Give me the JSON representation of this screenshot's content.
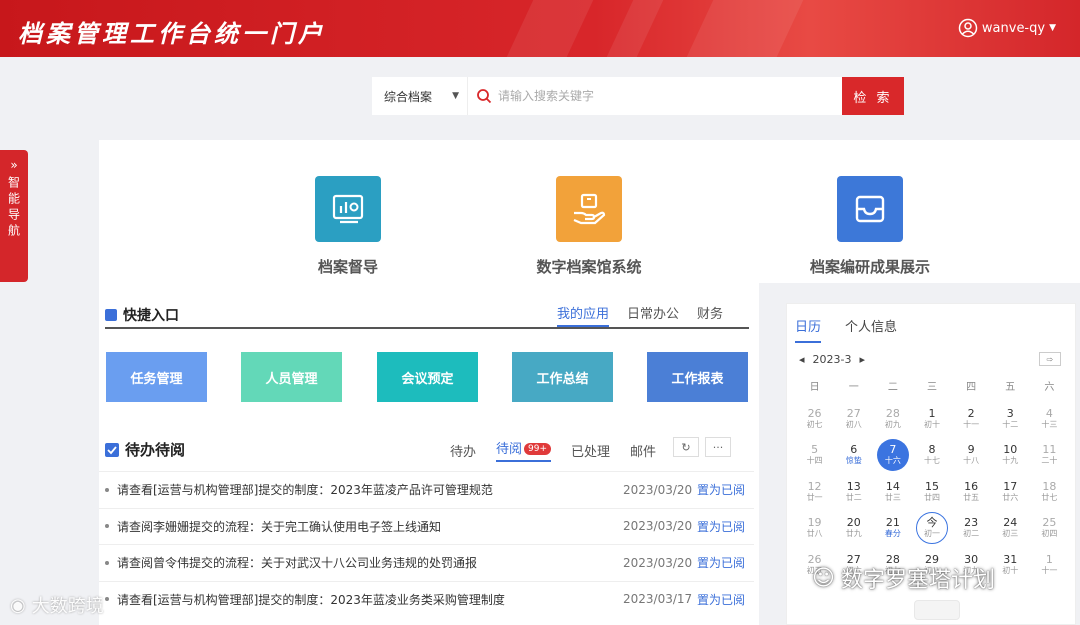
{
  "header": {
    "title": "档案管理工作台统一门户",
    "user": "wanve-qy"
  },
  "search": {
    "scope": "综合档案",
    "placeholder": "请输入搜索关键字",
    "button": "检 索"
  },
  "side_nav": {
    "label": "智能导航"
  },
  "systems": [
    {
      "label": "档案督导",
      "color": "#2b9fc2"
    },
    {
      "label": "数字档案馆系统",
      "color": "#f2a23a"
    },
    {
      "label": "档案编研成果展示",
      "color": "#3d78d8"
    }
  ],
  "quick_entry": {
    "title": "快捷入口",
    "tabs": [
      "我的应用",
      "日常办公",
      "财务"
    ],
    "buttons": [
      {
        "label": "任务管理",
        "color": "#6a9ef0"
      },
      {
        "label": "人员管理",
        "color": "#63d8b8"
      },
      {
        "label": "会议预定",
        "color": "#1dbcbd"
      },
      {
        "label": "工作总结",
        "color": "#47a9c4"
      },
      {
        "label": "工作报表",
        "color": "#4b7fd6"
      }
    ]
  },
  "todo": {
    "title": "待办待阅",
    "tabs": [
      "待办",
      "待阅",
      "已处理",
      "邮件"
    ],
    "badge": "99+",
    "rows": [
      {
        "text": "请查看[运营与机构管理部]提交的制度：2023年蓝凌产品许可管理规范",
        "date": "2023/03/20",
        "action": "置为已阅"
      },
      {
        "text": "请查阅李姗姗提交的流程：关于完工确认使用电子签上线通知",
        "date": "2023/03/20",
        "action": "置为已阅"
      },
      {
        "text": "请查阅曾令伟提交的流程：关于对武汉十八公司业务违规的处罚通报",
        "date": "2023/03/20",
        "action": "置为已阅"
      },
      {
        "text": "请查看[运营与机构管理部]提交的制度：2023年蓝凌业务类采购管理制度",
        "date": "2023/03/17",
        "action": "置为已阅"
      }
    ]
  },
  "calendar": {
    "tabs": [
      "日历",
      "个人信息"
    ],
    "month": "2023-3",
    "today_btn": "今",
    "weekdays": [
      "日",
      "一",
      "二",
      "三",
      "四",
      "五",
      "六"
    ],
    "days": [
      {
        "n": "26",
        "l": "初七",
        "muted": true
      },
      {
        "n": "27",
        "l": "初八",
        "muted": true
      },
      {
        "n": "28",
        "l": "初九",
        "muted": true
      },
      {
        "n": "1",
        "l": "初十"
      },
      {
        "n": "2",
        "l": "十一"
      },
      {
        "n": "3",
        "l": "十二"
      },
      {
        "n": "4",
        "l": "十三",
        "muted": true
      },
      {
        "n": "5",
        "l": "十四",
        "muted": true
      },
      {
        "n": "6",
        "l": "惊蛰",
        "holiday": true
      },
      {
        "n": "7",
        "l": "十六",
        "selected": true
      },
      {
        "n": "8",
        "l": "十七"
      },
      {
        "n": "9",
        "l": "十八"
      },
      {
        "n": "10",
        "l": "十九"
      },
      {
        "n": "11",
        "l": "二十",
        "muted": true
      },
      {
        "n": "12",
        "l": "廿一",
        "muted": true
      },
      {
        "n": "13",
        "l": "廿二"
      },
      {
        "n": "14",
        "l": "廿三"
      },
      {
        "n": "15",
        "l": "廿四"
      },
      {
        "n": "16",
        "l": "廿五"
      },
      {
        "n": "17",
        "l": "廿六"
      },
      {
        "n": "18",
        "l": "廿七",
        "muted": true
      },
      {
        "n": "19",
        "l": "廿八",
        "muted": true
      },
      {
        "n": "20",
        "l": "廿九"
      },
      {
        "n": "21",
        "l": "春分",
        "holiday": true
      },
      {
        "n": "今",
        "l": "初一",
        "today": true
      },
      {
        "n": "23",
        "l": "初二"
      },
      {
        "n": "24",
        "l": "初三"
      },
      {
        "n": "25",
        "l": "初四",
        "muted": true
      },
      {
        "n": "26",
        "l": "初五",
        "muted": true
      },
      {
        "n": "27",
        "l": "初六"
      },
      {
        "n": "28",
        "l": "初七"
      },
      {
        "n": "29",
        "l": "初八"
      },
      {
        "n": "30",
        "l": "初九"
      },
      {
        "n": "31",
        "l": "初十"
      },
      {
        "n": "1",
        "l": "十一",
        "muted": true
      }
    ]
  },
  "watermarks": {
    "left": "大数跨境",
    "right": "数字罗塞塔计划"
  }
}
